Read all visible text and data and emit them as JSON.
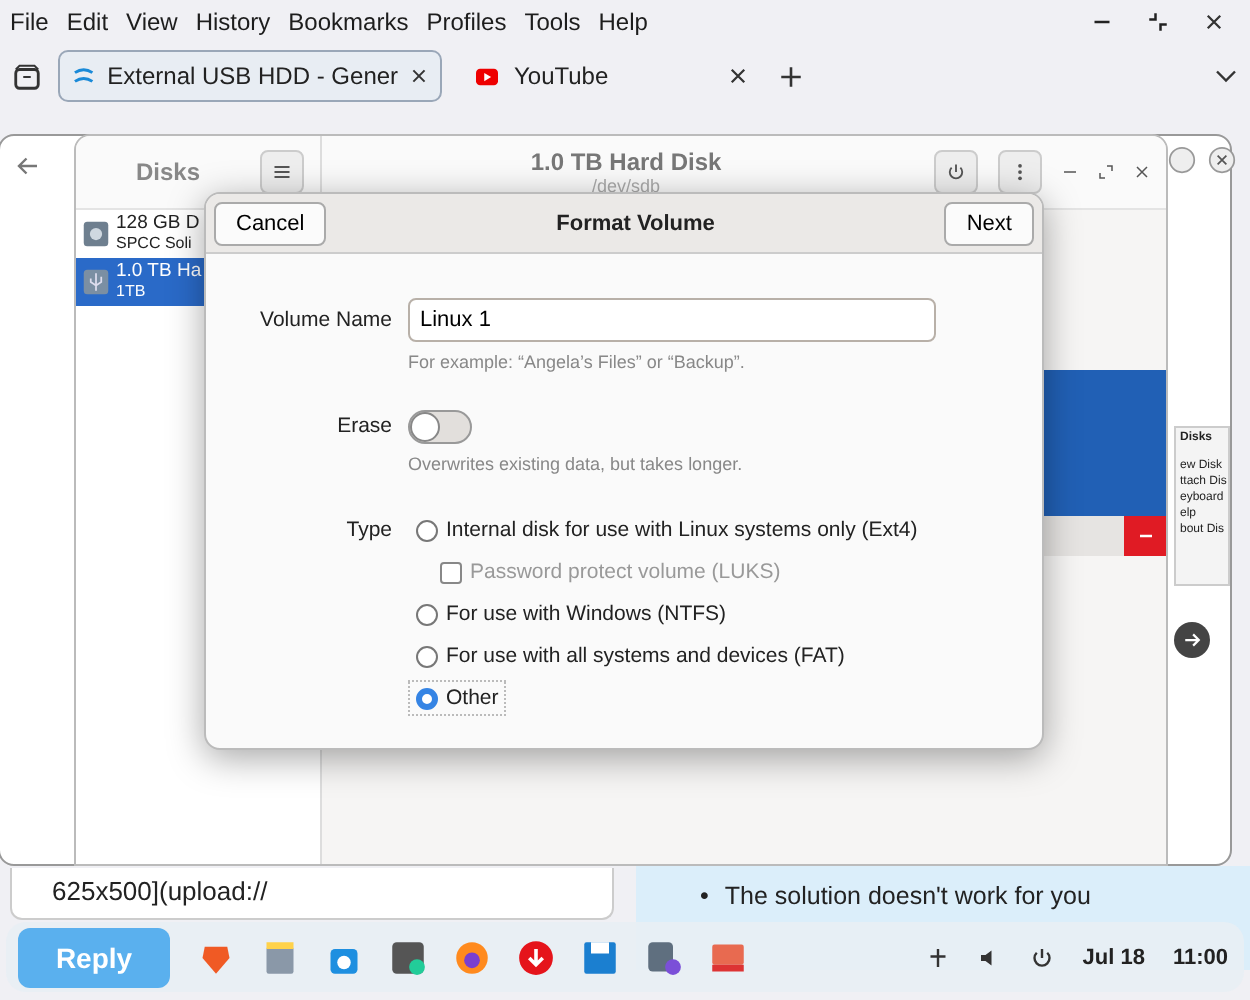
{
  "browser": {
    "menu": [
      "File",
      "Edit",
      "View",
      "History",
      "Bookmarks",
      "Profiles",
      "Tools",
      "Help"
    ],
    "tabs": [
      {
        "title": "External USB HDD - Gener",
        "selected": true
      },
      {
        "title": "YouTube",
        "selected": false
      }
    ]
  },
  "page": {
    "composer_text": "625x500](upload://",
    "reply_button": "Reply",
    "bullets": [
      {
        "marker": "•",
        "text": "The solution doesn't work for you"
      }
    ],
    "side_menu": [
      "Disks",
      "ew Disk",
      "ttach Dis",
      "eyboard",
      "elp",
      "bout Dis"
    ]
  },
  "disks": {
    "sidebar_title": "Disks",
    "title": "1.0 TB Hard Disk",
    "subtitle": "/dev/sdb",
    "drives": [
      {
        "name": "128 GB D",
        "detail": "SPCC Soli",
        "kind": "disk",
        "selected": false
      },
      {
        "name": "1.0 TB Ha",
        "detail": "1TB",
        "kind": "usb",
        "selected": true
      }
    ]
  },
  "dialog": {
    "title": "Format Volume",
    "cancel": "Cancel",
    "next": "Next",
    "volume_name": {
      "label": "Volume Name",
      "value": "Linux 1",
      "hint": "For example: “Angela’s Files” or “Backup”."
    },
    "erase": {
      "label": "Erase",
      "on": false,
      "hint": "Overwrites existing data, but takes longer."
    },
    "type": {
      "label": "Type",
      "options": [
        {
          "kind": "radio",
          "label": "Internal disk for use with Linux systems only (Ext4)",
          "selected": false
        },
        {
          "kind": "checkbox",
          "label": "Password protect volume (LUKS)",
          "checked": false,
          "disabled": true
        },
        {
          "kind": "radio",
          "label": "For use with Windows (NTFS)",
          "selected": false
        },
        {
          "kind": "radio",
          "label": "For use with all systems and devices (FAT)",
          "selected": false
        },
        {
          "kind": "radio",
          "label": "Other",
          "selected": true
        }
      ]
    }
  },
  "taskbar": {
    "date": "Jul 18",
    "time": "11:00"
  }
}
